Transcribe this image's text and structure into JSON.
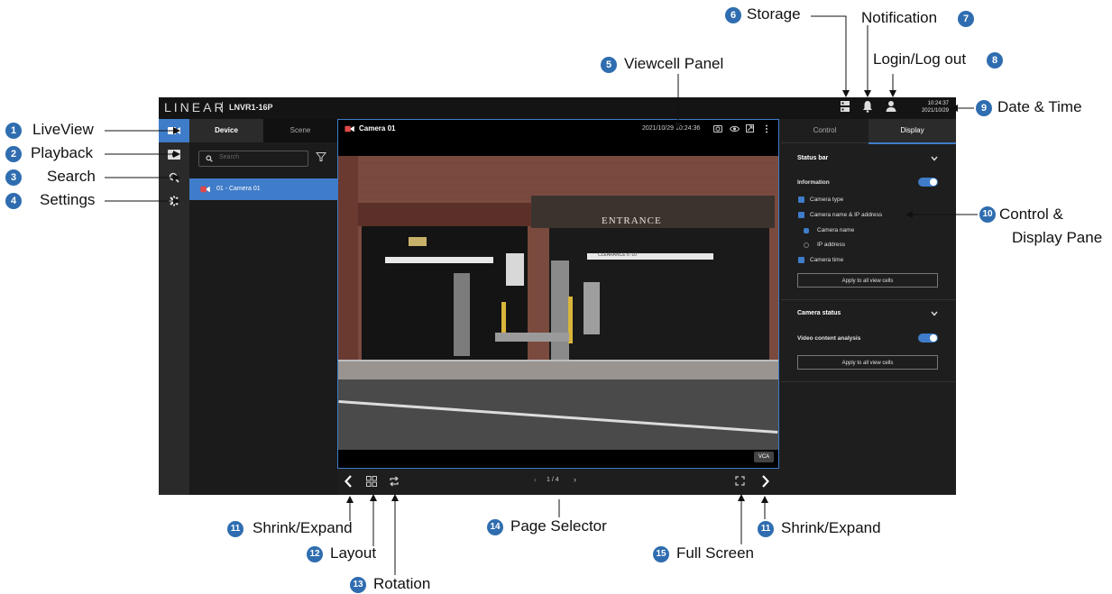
{
  "header": {
    "logo": "LINEAR",
    "separator": "|",
    "model": "LNVR1-16P",
    "time": "10:24:37",
    "date": "2021/10/29"
  },
  "device_panel": {
    "tabs": [
      "Device",
      "Scene"
    ],
    "search_placeholder": "Search",
    "devices": [
      {
        "label": "01 - Camera 01"
      }
    ]
  },
  "viewcell": {
    "camera_title": "Camera 01",
    "timestamp": "2021/10/29 10:24:36",
    "vca_label": "VCA",
    "scene_sign": "ENTRANCE",
    "clearance_sign": "CLEARANCE 6'-10\""
  },
  "right_panel": {
    "tabs": [
      "Control",
      "Display"
    ],
    "status_bar": {
      "title": "Status bar",
      "information_label": "Information",
      "information_on": true,
      "items": [
        "Camera type",
        "Camera name & IP address",
        "Camera time"
      ],
      "name_options": [
        "Camera name",
        "IP address"
      ],
      "selected_option": "Camera name",
      "apply_label": "Apply to all view cells"
    },
    "camera_status": {
      "title": "Camera status",
      "vca_label": "Video content analysis",
      "vca_on": true,
      "apply_label": "Apply to all view cells"
    }
  },
  "bottom_bar": {
    "page_current": "1",
    "page_total": "4",
    "page_text": "1 / 4"
  },
  "annotations": {
    "liveview": {
      "num": "1",
      "label": "LiveView"
    },
    "playback": {
      "num": "2",
      "label": "Playback"
    },
    "search": {
      "num": "3",
      "label": "Search"
    },
    "settings": {
      "num": "4",
      "label": "Settings"
    },
    "viewcell_panel": {
      "num": "5",
      "label": "Viewcell Panel"
    },
    "storage": {
      "num": "6",
      "label": "Storage"
    },
    "notification": {
      "num": "7",
      "label": "Notification"
    },
    "login": {
      "num": "8",
      "label": "Login/Log out"
    },
    "date_time": {
      "num": "9",
      "label": "Date & Time"
    },
    "control_display": {
      "num": "10",
      "label_line1": "Control &",
      "label_line2": "Display Pane"
    },
    "shrink_left": {
      "num": "11",
      "label": "Shrink/Expand"
    },
    "layout": {
      "num": "12",
      "label": "Layout"
    },
    "rotation": {
      "num": "13",
      "label": "Rotation"
    },
    "page_selector": {
      "num": "14",
      "label": "Page Selector"
    },
    "full_screen": {
      "num": "15",
      "label": "Full Screen"
    },
    "shrink_right": {
      "num": "11",
      "label": "Shrink/Expand"
    }
  },
  "colors": {
    "accent": "#3f7cc9",
    "badge": "#2f6db0",
    "app_bg": "#1e1e1e"
  }
}
